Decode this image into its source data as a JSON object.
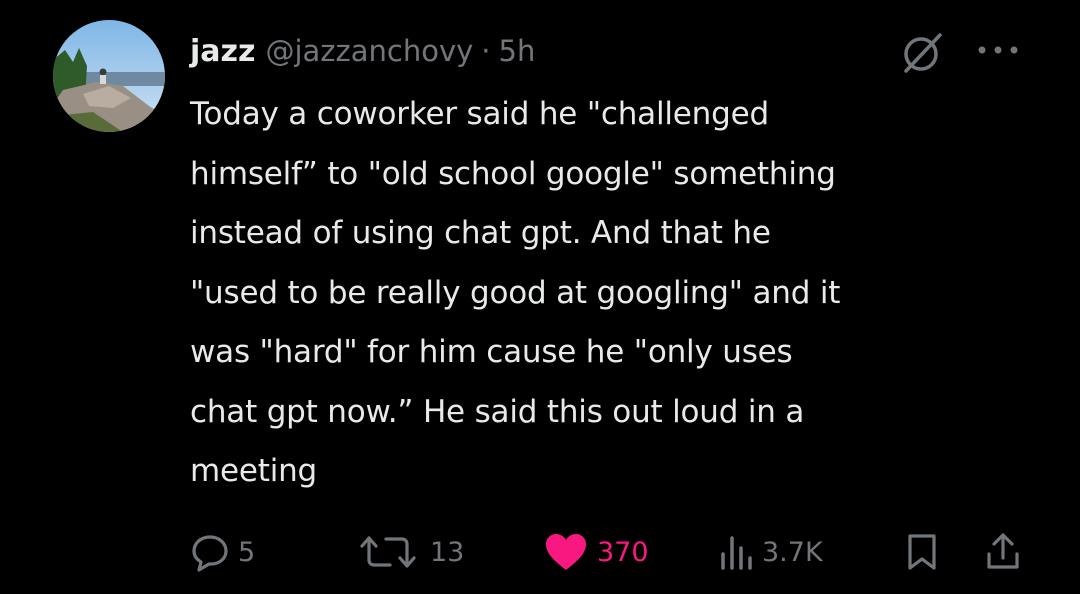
{
  "author": {
    "display_name": "jazz",
    "handle": "@jazzanchovy",
    "separator": "·",
    "time": "5h",
    "avatar_icon": "avatar-landscape-photo"
  },
  "tweet": {
    "text": "Today a coworker said he \"challenged\nhimself” to \"old school google\" something\ninstead of using chat gpt. And that he\n\"used to be really good at googling\" and it\nwas \"hard\" for him cause he \"only uses\nchat gpt now.” He said this out loud in a\nmeeting"
  },
  "icons": {
    "grok": "grok-icon",
    "more": "more-icon"
  },
  "actions": {
    "replies": "5",
    "reposts": "13",
    "likes": "370",
    "views": "3.7K"
  },
  "colors": {
    "background": "#000000",
    "text": "#e7e9ea",
    "muted": "#71767b",
    "like": "#f91880"
  }
}
